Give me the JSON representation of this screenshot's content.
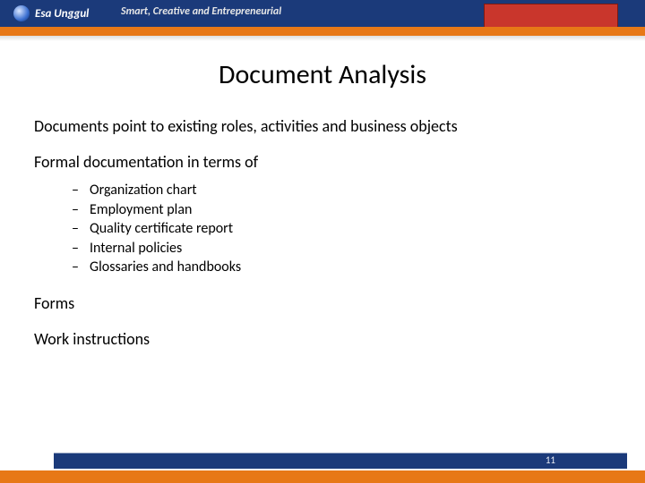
{
  "header": {
    "brand": "Esa Unggul",
    "tagline": "Smart, Creative and Entrepreneurial"
  },
  "slide": {
    "title": "Document Analysis",
    "lines": {
      "intro": "Documents point to existing roles, activities and business objects",
      "formal": "Formal documentation in terms of",
      "forms": "Forms",
      "work": "Work instructions"
    },
    "formal_items": [
      "Organization chart",
      "Employment plan",
      "Quality certificate report",
      "Internal policies",
      "Glossaries and handbooks"
    ]
  },
  "footer": {
    "page": "11"
  }
}
